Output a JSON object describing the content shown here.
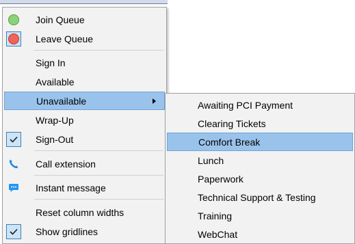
{
  "main_menu": {
    "items": [
      {
        "label": "Join Queue",
        "icon": "green-circle-icon",
        "color": "#8cd27a"
      },
      {
        "label": "Leave Queue",
        "icon": "red-circle-icon",
        "color": "#f0645a"
      },
      {
        "label": "Sign In"
      },
      {
        "label": "Available"
      },
      {
        "label": "Unavailable",
        "has_submenu": true,
        "highlighted": true
      },
      {
        "label": "Wrap-Up"
      },
      {
        "label": "Sign-Out",
        "checked": true
      },
      {
        "label": "Call extension",
        "icon": "phone-icon"
      },
      {
        "label": "Instant message",
        "icon": "chat-bubble-icon"
      },
      {
        "label": "Reset column widths"
      },
      {
        "label": "Show gridlines",
        "checked": true
      }
    ]
  },
  "submenu": {
    "items": [
      {
        "label": "Awaiting PCI Payment"
      },
      {
        "label": "Clearing Tickets"
      },
      {
        "label": "Comfort Break",
        "highlighted": true
      },
      {
        "label": "Lunch"
      },
      {
        "label": "Paperwork"
      },
      {
        "label": "Technical Support & Testing"
      },
      {
        "label": "Training"
      },
      {
        "label": "WebChat"
      }
    ]
  },
  "colors": {
    "highlight": "#9ac3ec",
    "menu_background": "#f2f2f2",
    "check_box": "#cce4f7",
    "icon_blue": "#1e88e5"
  }
}
